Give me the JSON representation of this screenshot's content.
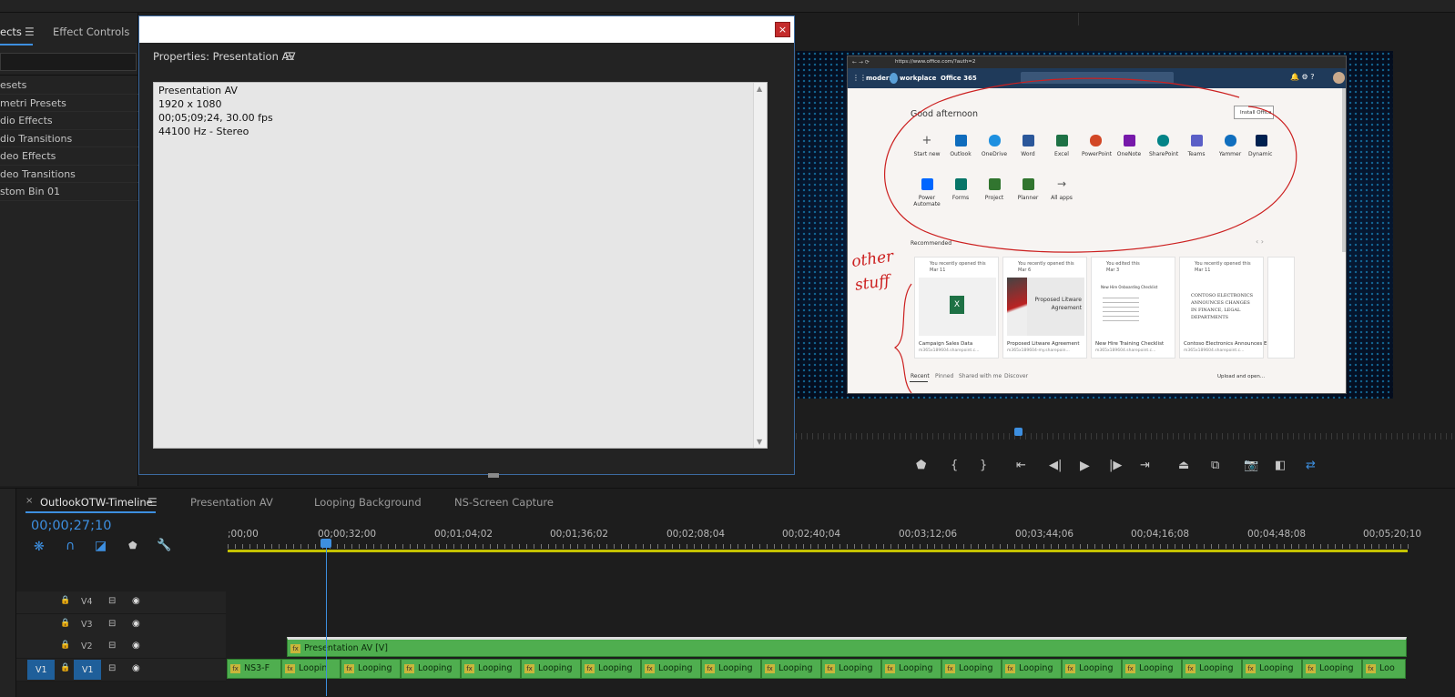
{
  "effects_panel": {
    "tab_effects": "ects",
    "tab_effect_controls": "Effect Controls",
    "items": [
      "esets",
      "metri Presets",
      "dio Effects",
      "dio Transitions",
      "deo Effects",
      "deo Transitions",
      "stom Bin 01"
    ]
  },
  "dialog": {
    "close_label": "×",
    "header": "Properties: Presentation AV",
    "lines": [
      "Presentation AV",
      "1920 x 1080",
      "00;05;09;24, 30.00 fps",
      "44100 Hz - Stereo"
    ]
  },
  "program_monitor": {
    "url": "https://www.office.com/?auth=2",
    "brand_left": "modern",
    "brand_right": "workplace",
    "office_label": "Office 365",
    "greeting": "Good afternoon",
    "install_label": "Install Office",
    "apps_row1": [
      "Start new",
      "Outlook",
      "OneDrive",
      "Word",
      "Excel",
      "PowerPoint",
      "OneNote",
      "SharePoint",
      "Teams",
      "Yammer",
      "Dynamic 365"
    ],
    "apps_row2": [
      "Power Automate",
      "Forms",
      "Project",
      "Planner",
      "All apps"
    ],
    "recommended": "Recommended",
    "cards": [
      {
        "meta": "You recently opened this",
        "date": "Mar 11",
        "title": "Campaign Sales Data",
        "sub": "m365x189604.sharepoint.c...",
        "thumb_text": ""
      },
      {
        "meta": "You recently opened this",
        "date": "Mar 6",
        "title": "Proposed Litware Agreement",
        "sub": "m365x189604-my.sharepoin...",
        "thumb_text": "Proposed Litware Agreement"
      },
      {
        "meta": "You edited this",
        "date": "Mar 3",
        "title": "New Hire Training Checklist",
        "sub": "m365x189604.sharepoint.c...",
        "thumb_text": "New Hire Onboarding Checklist"
      },
      {
        "meta": "You recently opened this",
        "date": "Mar 11",
        "title": "Contoso Electronics Announces Ele...",
        "sub": "m365x189604.sharepoint.c...",
        "thumb_text": "CONTOSO ELECTRONICS ANNOUNCES CHANGES IN FINANCE, LEGAL DEPARTMENTS"
      }
    ],
    "bottom_tabs": [
      "Recent",
      "Pinned",
      "Shared with me",
      "Discover"
    ],
    "upload_label": "Upload and open...",
    "annotation_text": "other stuff",
    "colors": {
      "annotation": "#cc2020",
      "o365_bar": "#1f3a5a",
      "monitor_bg": "#061a36"
    }
  },
  "timeline": {
    "close_label": "×",
    "tabs": [
      "OutlookOTW-Timeline",
      "Presentation AV",
      "Looping Background",
      "NS-Screen Capture"
    ],
    "timecode": "00;00;27;10",
    "ruler_labels": [
      ";00;00",
      "00;00;32;00",
      "00;01;04;02",
      "00;01;36;02",
      "00;02;08;04",
      "00;02;40;04",
      "00;03;12;06",
      "00;03;44;06",
      "00;04;16;08",
      "00;04;48;08",
      "00;05;20;10"
    ],
    "tracks": [
      "V4",
      "V3",
      "V2",
      "V1"
    ],
    "v1_source_label": "V1",
    "v2_clip": "Presentation AV [V]",
    "v1_clips": [
      "NS3-F",
      "Loopin",
      "Looping",
      "Looping",
      "Looping",
      "Looping",
      "Looping",
      "Looping",
      "Looping",
      "Looping",
      "Looping",
      "Looping",
      "Looping",
      "Looping",
      "Looping",
      "Looping",
      "Looping",
      "Looping",
      "Looping",
      "Loo"
    ],
    "colors": {
      "clip": "#4fae4f",
      "timecode": "#3d8fe0",
      "work_area": "#c4c200"
    }
  }
}
